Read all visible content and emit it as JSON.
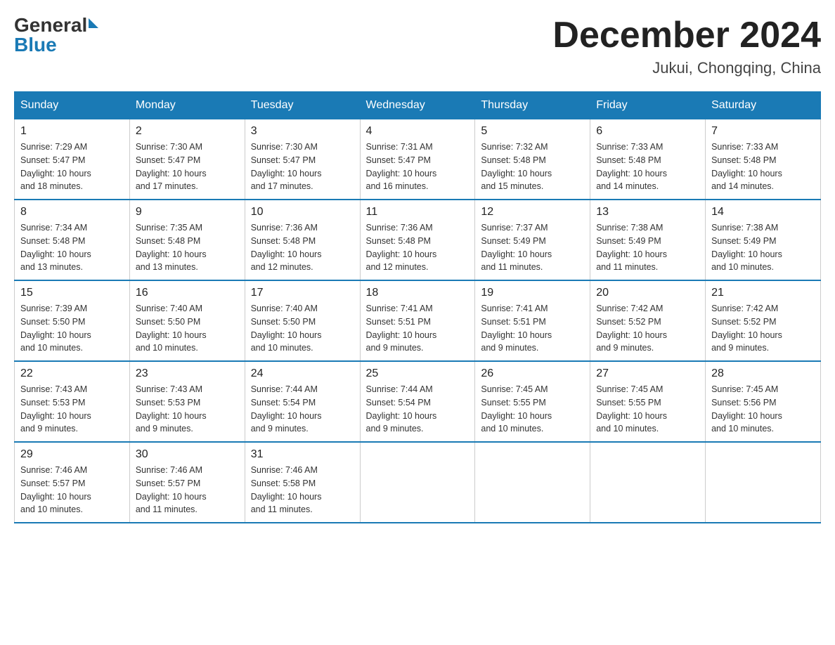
{
  "header": {
    "logo_general": "General",
    "logo_blue": "Blue",
    "title": "December 2024",
    "location": "Jukui, Chongqing, China"
  },
  "weekdays": [
    "Sunday",
    "Monday",
    "Tuesday",
    "Wednesday",
    "Thursday",
    "Friday",
    "Saturday"
  ],
  "weeks": [
    [
      {
        "day": "1",
        "sunrise": "7:29 AM",
        "sunset": "5:47 PM",
        "daylight": "10 hours and 18 minutes."
      },
      {
        "day": "2",
        "sunrise": "7:30 AM",
        "sunset": "5:47 PM",
        "daylight": "10 hours and 17 minutes."
      },
      {
        "day": "3",
        "sunrise": "7:30 AM",
        "sunset": "5:47 PM",
        "daylight": "10 hours and 17 minutes."
      },
      {
        "day": "4",
        "sunrise": "7:31 AM",
        "sunset": "5:47 PM",
        "daylight": "10 hours and 16 minutes."
      },
      {
        "day": "5",
        "sunrise": "7:32 AM",
        "sunset": "5:48 PM",
        "daylight": "10 hours and 15 minutes."
      },
      {
        "day": "6",
        "sunrise": "7:33 AM",
        "sunset": "5:48 PM",
        "daylight": "10 hours and 14 minutes."
      },
      {
        "day": "7",
        "sunrise": "7:33 AM",
        "sunset": "5:48 PM",
        "daylight": "10 hours and 14 minutes."
      }
    ],
    [
      {
        "day": "8",
        "sunrise": "7:34 AM",
        "sunset": "5:48 PM",
        "daylight": "10 hours and 13 minutes."
      },
      {
        "day": "9",
        "sunrise": "7:35 AM",
        "sunset": "5:48 PM",
        "daylight": "10 hours and 13 minutes."
      },
      {
        "day": "10",
        "sunrise": "7:36 AM",
        "sunset": "5:48 PM",
        "daylight": "10 hours and 12 minutes."
      },
      {
        "day": "11",
        "sunrise": "7:36 AM",
        "sunset": "5:48 PM",
        "daylight": "10 hours and 12 minutes."
      },
      {
        "day": "12",
        "sunrise": "7:37 AM",
        "sunset": "5:49 PM",
        "daylight": "10 hours and 11 minutes."
      },
      {
        "day": "13",
        "sunrise": "7:38 AM",
        "sunset": "5:49 PM",
        "daylight": "10 hours and 11 minutes."
      },
      {
        "day": "14",
        "sunrise": "7:38 AM",
        "sunset": "5:49 PM",
        "daylight": "10 hours and 10 minutes."
      }
    ],
    [
      {
        "day": "15",
        "sunrise": "7:39 AM",
        "sunset": "5:50 PM",
        "daylight": "10 hours and 10 minutes."
      },
      {
        "day": "16",
        "sunrise": "7:40 AM",
        "sunset": "5:50 PM",
        "daylight": "10 hours and 10 minutes."
      },
      {
        "day": "17",
        "sunrise": "7:40 AM",
        "sunset": "5:50 PM",
        "daylight": "10 hours and 10 minutes."
      },
      {
        "day": "18",
        "sunrise": "7:41 AM",
        "sunset": "5:51 PM",
        "daylight": "10 hours and 9 minutes."
      },
      {
        "day": "19",
        "sunrise": "7:41 AM",
        "sunset": "5:51 PM",
        "daylight": "10 hours and 9 minutes."
      },
      {
        "day": "20",
        "sunrise": "7:42 AM",
        "sunset": "5:52 PM",
        "daylight": "10 hours and 9 minutes."
      },
      {
        "day": "21",
        "sunrise": "7:42 AM",
        "sunset": "5:52 PM",
        "daylight": "10 hours and 9 minutes."
      }
    ],
    [
      {
        "day": "22",
        "sunrise": "7:43 AM",
        "sunset": "5:53 PM",
        "daylight": "10 hours and 9 minutes."
      },
      {
        "day": "23",
        "sunrise": "7:43 AM",
        "sunset": "5:53 PM",
        "daylight": "10 hours and 9 minutes."
      },
      {
        "day": "24",
        "sunrise": "7:44 AM",
        "sunset": "5:54 PM",
        "daylight": "10 hours and 9 minutes."
      },
      {
        "day": "25",
        "sunrise": "7:44 AM",
        "sunset": "5:54 PM",
        "daylight": "10 hours and 9 minutes."
      },
      {
        "day": "26",
        "sunrise": "7:45 AM",
        "sunset": "5:55 PM",
        "daylight": "10 hours and 10 minutes."
      },
      {
        "day": "27",
        "sunrise": "7:45 AM",
        "sunset": "5:55 PM",
        "daylight": "10 hours and 10 minutes."
      },
      {
        "day": "28",
        "sunrise": "7:45 AM",
        "sunset": "5:56 PM",
        "daylight": "10 hours and 10 minutes."
      }
    ],
    [
      {
        "day": "29",
        "sunrise": "7:46 AM",
        "sunset": "5:57 PM",
        "daylight": "10 hours and 10 minutes."
      },
      {
        "day": "30",
        "sunrise": "7:46 AM",
        "sunset": "5:57 PM",
        "daylight": "10 hours and 11 minutes."
      },
      {
        "day": "31",
        "sunrise": "7:46 AM",
        "sunset": "5:58 PM",
        "daylight": "10 hours and 11 minutes."
      },
      null,
      null,
      null,
      null
    ]
  ],
  "labels": {
    "sunrise": "Sunrise:",
    "sunset": "Sunset:",
    "daylight": "Daylight:"
  }
}
